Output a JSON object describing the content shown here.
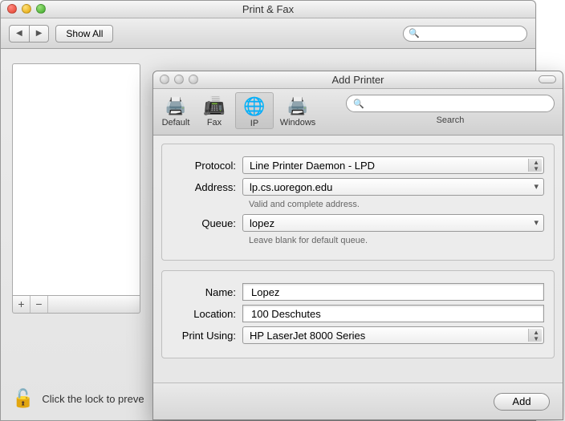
{
  "back": {
    "title": "Print & Fax",
    "showAll": "Show All",
    "lock_text": "Click the lock to preve"
  },
  "front": {
    "title": "Add Printer",
    "toolbar": {
      "default": "Default",
      "fax": "Fax",
      "ip": "IP",
      "windows": "Windows",
      "search_label": "Search"
    },
    "labels": {
      "protocol": "Protocol:",
      "address": "Address:",
      "queue": "Queue:",
      "name": "Name:",
      "location": "Location:",
      "print_using": "Print Using:"
    },
    "values": {
      "protocol": "Line Printer Daemon - LPD",
      "address": "lp.cs.uoregon.edu",
      "address_hint": "Valid and complete address.",
      "queue": "lopez",
      "queue_hint": "Leave blank for default queue.",
      "name": "Lopez",
      "location": "100 Deschutes",
      "print_using": "HP LaserJet 8000 Series"
    },
    "add": "Add"
  }
}
